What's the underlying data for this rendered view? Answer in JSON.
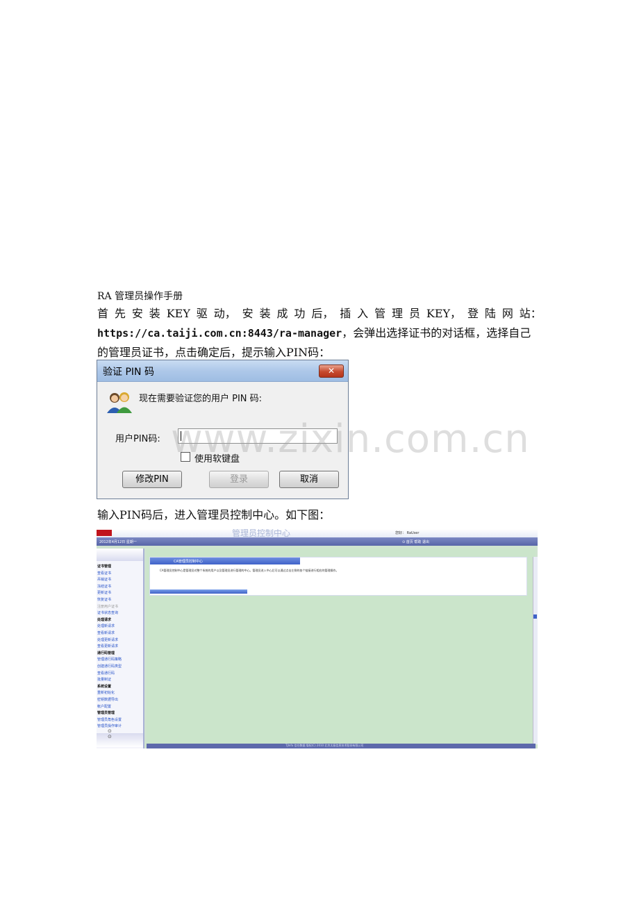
{
  "document": {
    "title": "RA 管理员操作手册",
    "para1_line1_tokens": [
      "首",
      "先",
      "安",
      "装",
      "KEY",
      "驱",
      "动，",
      "安",
      "装",
      "成",
      "功",
      "后，",
      "插",
      "入",
      "管",
      "理",
      "员",
      "KEY，",
      "登",
      "陆",
      "网",
      "站："
    ],
    "para1_url": "https://ca.taiji.com.cn:8443/ra-manager",
    "para1_line2_rest": "，会弹出选择证书的对话框，选择自己",
    "para1_line3": "的管理员证书，点击确定后，提示输入PIN码：",
    "para2": "输入PIN码后，进入管理员控制中心。如下图："
  },
  "pin_dialog": {
    "title": "验证 PIN 码",
    "close_glyph": "✕",
    "prompt": "现在需要验证您的用户 PIN 码:",
    "pin_label": "用户PIN码:",
    "soft_keyboard_label": "使用软键盘",
    "buttons": {
      "modify": "修改PIN",
      "login": "登录",
      "cancel": "取消"
    },
    "icons": {
      "user_icon": "users-icon"
    }
  },
  "watermark": "www.zixin.com.cn",
  "console": {
    "header_title": "管理员控制中心",
    "user_text": "您好：  RaUser",
    "date_text": "2012年4月12日  星期一",
    "top_nav": "⊙ 首页   帮助   退出",
    "sidebar": [
      {
        "type": "group",
        "label": "证书管理"
      },
      {
        "type": "item",
        "label": "查看证书"
      },
      {
        "type": "item",
        "label": "吊销证书"
      },
      {
        "type": "item",
        "label": "冻结证书"
      },
      {
        "type": "item",
        "label": "更新证书"
      },
      {
        "type": "item",
        "label": "恢复证书"
      },
      {
        "type": "item",
        "label": "注册用户证书",
        "disabled": true
      },
      {
        "type": "item",
        "label": "证书状态查询"
      },
      {
        "type": "group",
        "label": "处理请求"
      },
      {
        "type": "item",
        "label": "处理新请求"
      },
      {
        "type": "item",
        "label": "查看新请求"
      },
      {
        "type": "item",
        "label": "处理更新请求"
      },
      {
        "type": "item",
        "label": "查看更新请求"
      },
      {
        "type": "group",
        "label": "通行码管理"
      },
      {
        "type": "item",
        "label": "管理通行码策略"
      },
      {
        "type": "item",
        "label": "创建通行码类型"
      },
      {
        "type": "item",
        "label": "查看通行码"
      },
      {
        "type": "item",
        "label": "批量制证"
      },
      {
        "type": "group",
        "label": "系统设置"
      },
      {
        "type": "item",
        "label": "重新初始化"
      },
      {
        "type": "item",
        "label": "密钥数据导出"
      },
      {
        "type": "item",
        "label": "帐户配置"
      },
      {
        "type": "group",
        "label": "管理员管理"
      },
      {
        "type": "item",
        "label": "管理员角色设置"
      },
      {
        "type": "item",
        "label": "管理员操作审计"
      }
    ],
    "sidebar_arrows": "⊙ ⊙",
    "tab_title": "CA管理员控制中心",
    "description": "CA管理员控制中心是管理员对整个系统的用户以及管理员进行管理的中心。管理员进入中心后可以通过点击左侧的各个链接进行相应的管理操作。",
    "footer_text": "TJInfo 信任数据  版权(C) 2010 北京太极信息技术股份有限公司"
  }
}
